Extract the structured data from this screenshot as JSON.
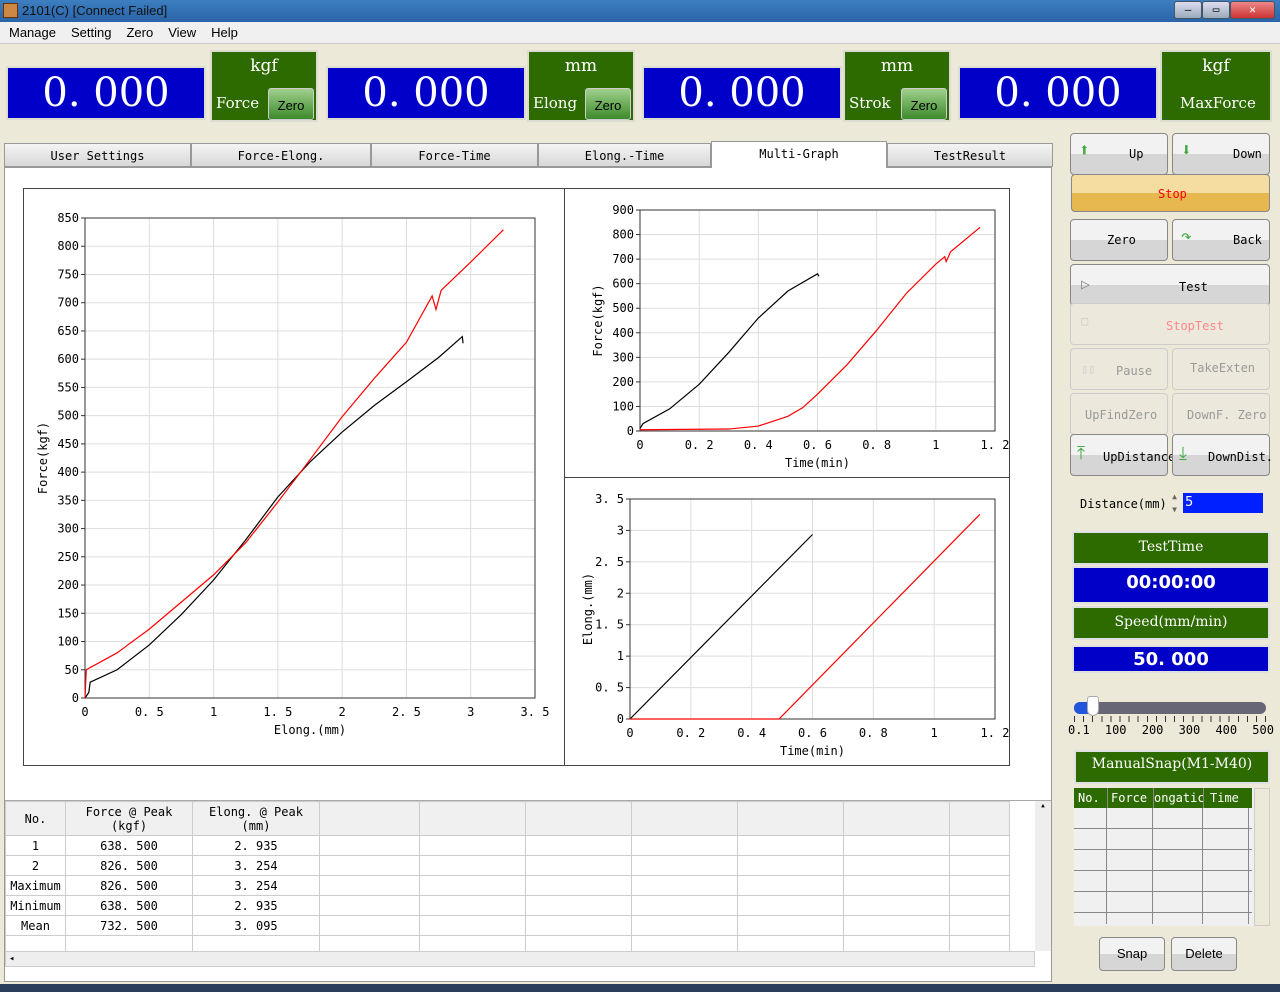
{
  "window": {
    "title": "2101(C)   [Connect Failed]",
    "min": "—",
    "max": "▭",
    "close": "✕"
  },
  "menu": [
    "Manage",
    "Setting",
    "Zero",
    "View",
    "Help"
  ],
  "readouts": [
    {
      "value": "0. 000",
      "unit": "kgf",
      "label": "Force",
      "zero": "Zero"
    },
    {
      "value": "0. 000",
      "unit": "mm",
      "label": "Elong",
      "zero": "Zero"
    },
    {
      "value": "0. 000",
      "unit": "mm",
      "label": "Strok",
      "zero": "Zero"
    },
    {
      "value": "0. 000",
      "unit": "kgf",
      "label": "MaxForce"
    }
  ],
  "tabs": [
    "User Settings",
    "Force-Elong.",
    "Force-Time",
    "Elong.-Time",
    "Multi-Graph",
    "TestResult"
  ],
  "active_tab": "Multi-Graph",
  "controls": {
    "up": "Up",
    "down": "Down",
    "stop": "Stop",
    "zero": "Zero",
    "back": "Back",
    "test": "Test",
    "stoptest": "StopTest",
    "pause": "Pause",
    "takeexten": "TakeExten",
    "upfindzero": "UpFindZero",
    "downfzero": "DownF. Zero",
    "updistance": "UpDistance",
    "downdist": "DownDist.",
    "distance_label": "Distance(mm)",
    "distance_value": "5"
  },
  "status": {
    "testtime_label": "TestTime",
    "testtime": "00:00:00",
    "speed_label": "Speed(mm/min)",
    "speed": "50. 000",
    "slider_value": 50,
    "slider_ticks": [
      "0.1",
      "100",
      "200",
      "300",
      "400",
      "500"
    ]
  },
  "snap": {
    "title": "ManualSnap(M1-M40)",
    "columns": [
      "No.",
      "Force",
      "ongatic",
      "Time"
    ],
    "snap": "Snap",
    "delete": "Delete"
  },
  "results": {
    "headers": [
      [
        "No.",
        ""
      ],
      [
        "Force @ Peak",
        "(kgf)"
      ],
      [
        "Elong. @ Peak",
        "(mm)"
      ]
    ],
    "rows": [
      [
        "1",
        "638. 500",
        "2. 935"
      ],
      [
        "2",
        "826. 500",
        "3. 254"
      ],
      [
        "Maximum",
        "826. 500",
        "3. 254"
      ],
      [
        "Minimum",
        "638. 500",
        "2. 935"
      ],
      [
        "Mean",
        "732. 500",
        "3. 095"
      ]
    ]
  },
  "colors": {
    "series1": "#000000",
    "series2": "#ff0000",
    "readout_bg": "#0000c8",
    "label_bg": "#2d6a00"
  },
  "chart_data": [
    {
      "type": "line",
      "xlabel": "Elong.(mm)",
      "ylabel": "Force(kgf)",
      "xlim": [
        0,
        3.5
      ],
      "ylim": [
        0,
        850
      ],
      "xticks": [
        "0",
        "0. 5",
        "1",
        "1. 5",
        "2",
        "2. 5",
        "3",
        "3. 5"
      ],
      "yticks": [
        "0",
        "50",
        "100",
        "150",
        "200",
        "250",
        "300",
        "350",
        "400",
        "450",
        "500",
        "550",
        "600",
        "650",
        "700",
        "750",
        "800",
        "850"
      ],
      "grid": true,
      "series": [
        {
          "color": "#000000",
          "points": [
            [
              0,
              0
            ],
            [
              0.03,
              10
            ],
            [
              0.04,
              28
            ],
            [
              0.25,
              50
            ],
            [
              0.5,
              94
            ],
            [
              0.75,
              148
            ],
            [
              1,
              209
            ],
            [
              1.25,
              280
            ],
            [
              1.5,
              356
            ],
            [
              1.75,
              418
            ],
            [
              2,
              471
            ],
            [
              2.25,
              518
            ],
            [
              2.5,
              560
            ],
            [
              2.75,
              603
            ],
            [
              2.935,
              640
            ],
            [
              2.94,
              628
            ]
          ]
        },
        {
          "color": "#ff0000",
          "points": [
            [
              0,
              0
            ],
            [
              0.01,
              50
            ],
            [
              0.25,
              80
            ],
            [
              0.5,
              122
            ],
            [
              0.75,
              170
            ],
            [
              1,
              218
            ],
            [
              1.25,
              275
            ],
            [
              1.5,
              347
            ],
            [
              1.75,
              422
            ],
            [
              2,
              498
            ],
            [
              2.25,
              566
            ],
            [
              2.5,
              630
            ],
            [
              2.7,
              712
            ],
            [
              2.73,
              688
            ],
            [
              2.77,
              722
            ],
            [
              3,
              772
            ],
            [
              3.254,
              829
            ]
          ]
        }
      ]
    },
    {
      "type": "line",
      "xlabel": "Time(min)",
      "ylabel": "Force(kgf)",
      "xlim": [
        0,
        1.2
      ],
      "ylim": [
        0,
        900
      ],
      "xticks": [
        "0",
        "0. 2",
        "0. 4",
        "0. 6",
        "0. 8",
        "1",
        "1. 2"
      ],
      "yticks": [
        "0",
        "100",
        "200",
        "300",
        "400",
        "500",
        "600",
        "700",
        "800",
        "900"
      ],
      "grid": true,
      "series": [
        {
          "color": "#000000",
          "points": [
            [
              0,
              10
            ],
            [
              0.01,
              30
            ],
            [
              0.1,
              90
            ],
            [
              0.2,
              190
            ],
            [
              0.3,
              320
            ],
            [
              0.4,
              460
            ],
            [
              0.5,
              570
            ],
            [
              0.6,
              640
            ],
            [
              0.605,
              630
            ]
          ]
        },
        {
          "color": "#ff0000",
          "points": [
            [
              0,
              5
            ],
            [
              0.3,
              8
            ],
            [
              0.4,
              20
            ],
            [
              0.5,
              60
            ],
            [
              0.55,
              95
            ],
            [
              0.6,
              150
            ],
            [
              0.7,
              270
            ],
            [
              0.8,
              410
            ],
            [
              0.9,
              560
            ],
            [
              1.0,
              680
            ],
            [
              1.03,
              710
            ],
            [
              1.035,
              690
            ],
            [
              1.05,
              730
            ],
            [
              1.15,
              830
            ]
          ]
        }
      ]
    },
    {
      "type": "line",
      "xlabel": "Time(min)",
      "ylabel": "Elong.(mm)",
      "xlim": [
        0,
        1.2
      ],
      "ylim": [
        0,
        3.5
      ],
      "xticks": [
        "0",
        "0. 2",
        "0. 4",
        "0. 6",
        "0. 8",
        "1",
        "1. 2"
      ],
      "yticks": [
        "0",
        "0. 5",
        "1",
        "1. 5",
        "2",
        "2. 5",
        "3",
        "3. 5"
      ],
      "grid": true,
      "series": [
        {
          "color": "#000000",
          "points": [
            [
              0,
              0
            ],
            [
              0.6,
              2.935
            ]
          ]
        },
        {
          "color": "#ff0000",
          "points": [
            [
              0,
              0
            ],
            [
              0.49,
              0
            ],
            [
              1.15,
              3.254
            ]
          ]
        }
      ]
    }
  ]
}
